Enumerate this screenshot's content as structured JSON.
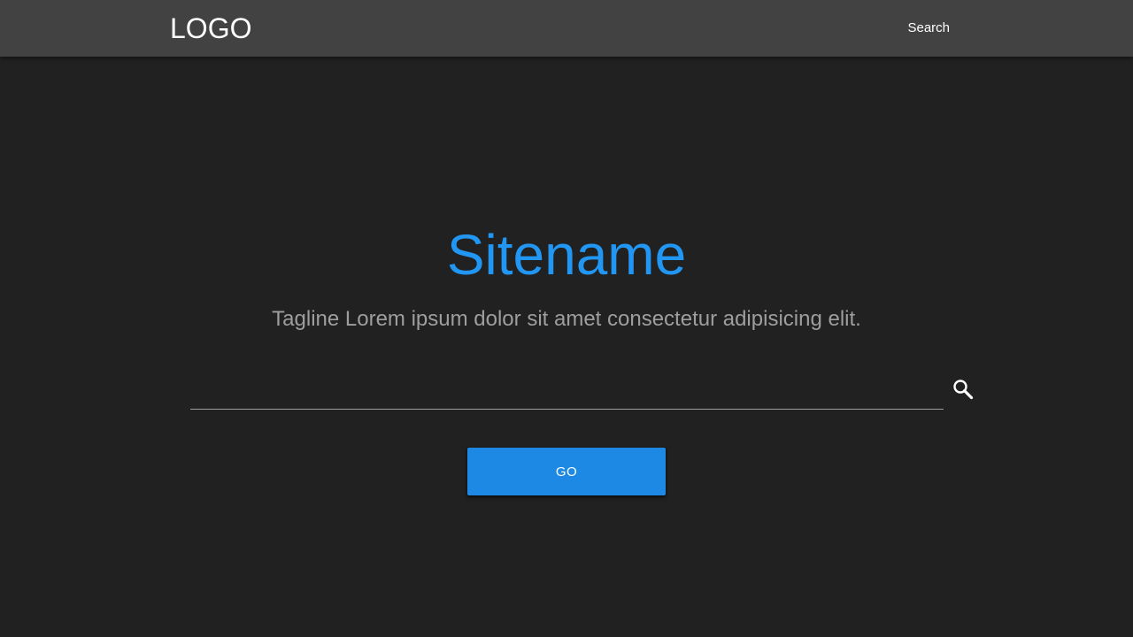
{
  "header": {
    "logo_text": "LOGO",
    "nav_search_label": "Search",
    "background_color": "#424242"
  },
  "hero": {
    "title": "Sitename",
    "tagline": "Tagline Lorem ipsum dolor sit amet consectetur adipisicing elit.",
    "title_color": "#2196F3",
    "tagline_color": "#9E9E9E"
  },
  "search": {
    "value": "",
    "placeholder": "",
    "icon": "search-icon"
  },
  "actions": {
    "go_label": "GO",
    "button_color": "#1E88E5"
  },
  "page": {
    "background_color": "#212121"
  }
}
